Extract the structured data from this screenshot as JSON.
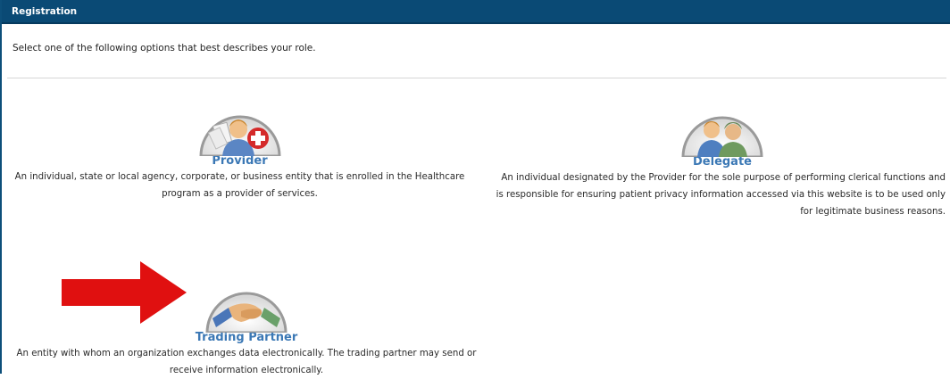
{
  "header": {
    "title": "Registration"
  },
  "intro": {
    "text": "Select one of the following options that best describes your role."
  },
  "options": [
    {
      "title": "Provider",
      "description": "An individual, state or local agency, corporate, or business entity that is enrolled in the Healthcare program as a provider of services.",
      "icon": "provider-person-medical-cross-icon"
    },
    {
      "title": "Delegate",
      "description": "An individual designated by the Provider for the sole purpose of performing clerical functions and is responsible for ensuring patient privacy information accessed via this website is to be used only for legitimate business reasons.",
      "icon": "delegate-two-people-icon"
    },
    {
      "title": "Trading Partner",
      "description": "An entity with whom an organization exchanges data electronically. The trading partner may send or receive information electronically.",
      "icon": "handshake-icon"
    }
  ],
  "annotation": {
    "icon": "red-arrow-icon",
    "color": "#e01010"
  },
  "colors": {
    "header": "#0a4a75",
    "title": "#3b78b5"
  }
}
